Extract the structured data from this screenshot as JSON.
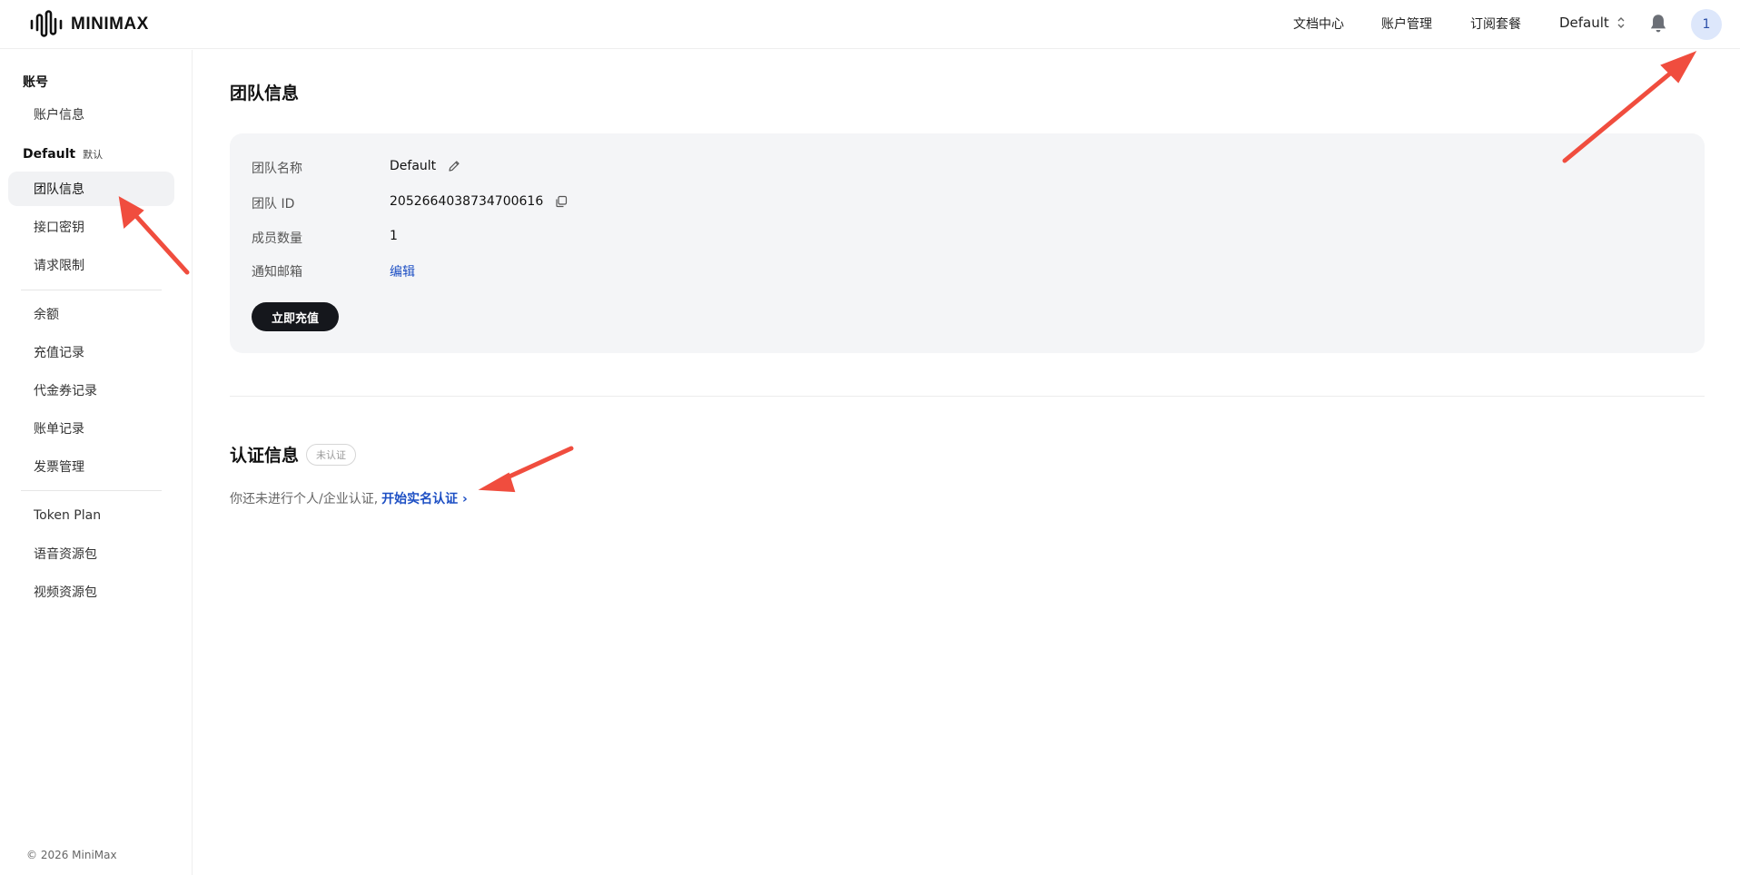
{
  "header": {
    "brand": "MINIMAX",
    "nav": [
      "文档中心",
      "账户管理",
      "订阅套餐"
    ],
    "team_select": "Default",
    "avatar_text": "1",
    "icons": [
      "logo-waveform-icon",
      "chevron-updown-icon",
      "bell-icon"
    ]
  },
  "sidebar": {
    "account_group": "账号",
    "account_items": [
      "账户信息"
    ],
    "team_group": "Default",
    "team_tag": "默认",
    "team_items": [
      "团队信息",
      "接口密钥",
      "请求限制"
    ],
    "billing_items": [
      "余额",
      "充值记录",
      "代金券记录",
      "账单记录",
      "发票管理"
    ],
    "plan_items": [
      "Token Plan",
      "语音资源包",
      "视频资源包"
    ],
    "active_item": "团队信息",
    "copyright": "© 2026 MiniMax"
  },
  "main": {
    "title": "团队信息",
    "rows": [
      {
        "label": "团队名称",
        "value": "Default",
        "icon": "pencil-icon"
      },
      {
        "label": "团队 ID",
        "value": "2052664038734700616",
        "icon": "copy-icon"
      },
      {
        "label": "成员数量",
        "value": "1"
      },
      {
        "label": "通知邮箱",
        "value": "编辑"
      }
    ],
    "recharge_button": "立即充值",
    "auth_title": "认证信息",
    "auth_badge": "未认证",
    "auth_desc": "你还未进行个人/企业认证,",
    "auth_link": "开始实名认证 ›"
  },
  "colors": {
    "accent_link": "#1d4fc4",
    "button_dark": "#15171c",
    "card_bg": "#f4f5f7",
    "annotation_arrow": "#f04d3e"
  }
}
